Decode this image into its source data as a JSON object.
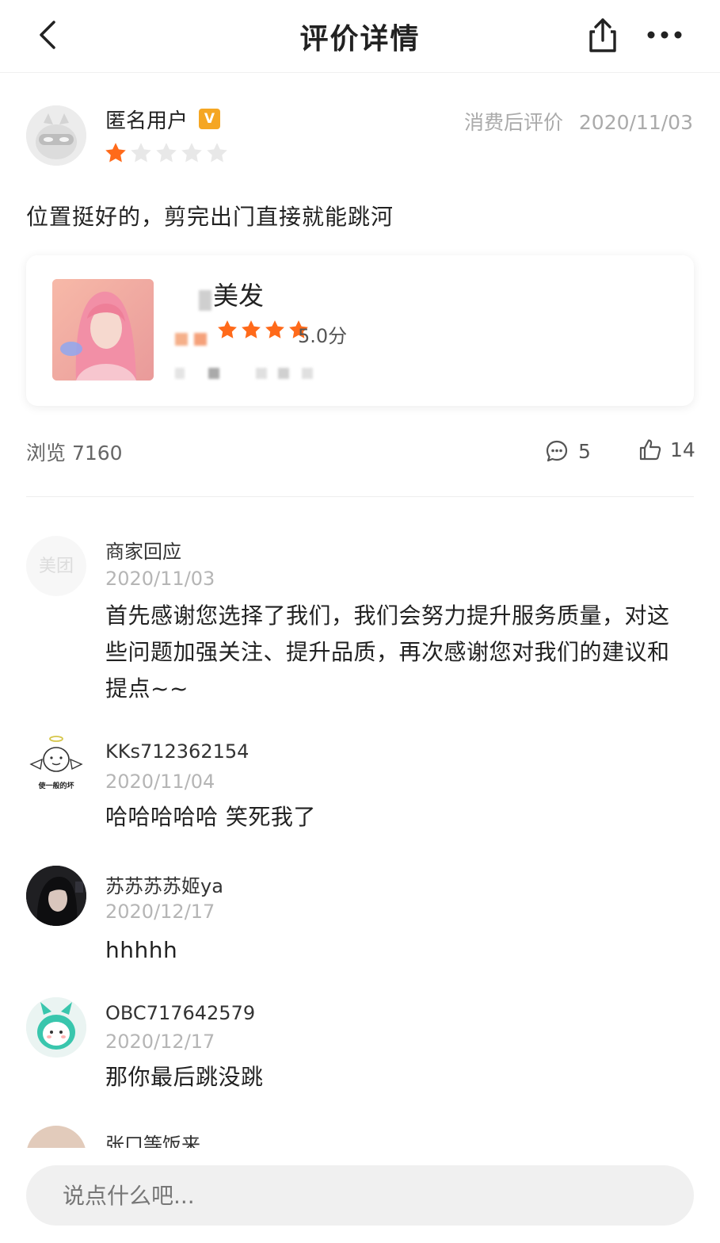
{
  "header": {
    "title": "评价详情",
    "back_icon": "chevron-left-icon",
    "share_icon": "share-icon",
    "more_icon": "more-dots-icon"
  },
  "review": {
    "user_name": "匿名用户",
    "badge": "V",
    "rating": 1,
    "rating_max": 5,
    "meta_label": "消费后评价",
    "date": "2020/11/03",
    "text": "位置挺好的，剪完出门直接就能跳河"
  },
  "merchant": {
    "name": "美发",
    "rating": 5.0,
    "score_text": "5.0分"
  },
  "stats": {
    "views_label": "浏览",
    "views": "7160",
    "comments": "5",
    "likes": "14"
  },
  "comments": [
    {
      "name": "商家回应",
      "avatar_text": "美团",
      "date": "2020/11/03",
      "text": "首先感谢您选择了我们，我们会努力提升服务质量，对这些问题加强关注、提升品质，再次感谢您对我们的建议和提点~~"
    },
    {
      "name": "KKs712362154",
      "avatar_text": "使一般的坏",
      "date": "2020/11/04",
      "text": "哈哈哈哈哈  笑死我了"
    },
    {
      "name": "苏苏苏苏姬ya",
      "date": "2020/12/17",
      "text": "hhhhh"
    },
    {
      "name": "OBC717642579",
      "date": "2020/12/17",
      "text": "那你最后跳没跳"
    },
    {
      "name": "张口等饭来"
    }
  ],
  "input": {
    "placeholder": "说点什么吧..."
  },
  "colors": {
    "star_active": "#ff6a1a",
    "star_inactive": "#e8e8e8",
    "badge": "#f5a623"
  }
}
